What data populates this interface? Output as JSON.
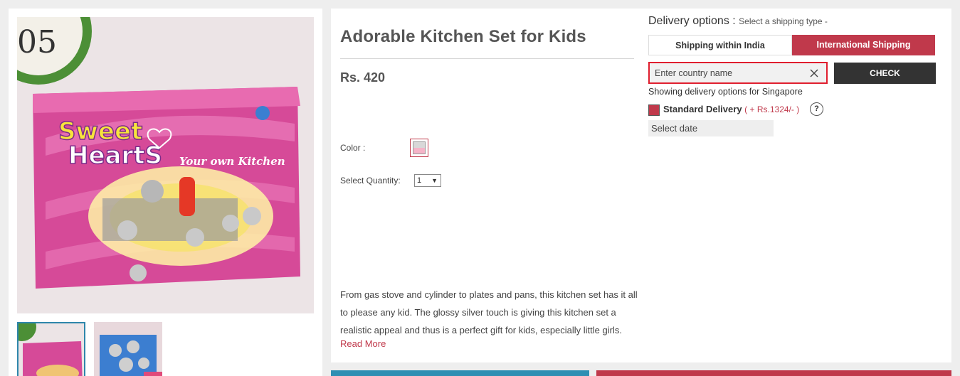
{
  "product": {
    "title": "Adorable Kitchen Set for Kids",
    "price": "Rs. 420",
    "color_label": "Color :",
    "quantity_label": "Select Quantity:",
    "quantity_value": "1",
    "description": "From gas stove and cylinder to plates and pans, this kitchen set has it all to please any kid. The glossy silver touch is giving this kitchen set a realistic appeal and thus is a perfect gift for kids, especially little girls.",
    "read_more": "Read More"
  },
  "image": {
    "box_title_line1": "Sweet",
    "box_title_line2": "HeartS",
    "box_tagline": "Your own Kitchen",
    "clock_text": "05"
  },
  "delivery": {
    "title": "Delivery options :",
    "subtitle": "Select a shipping type -",
    "tab_india": "Shipping within India",
    "tab_international": "International Shipping",
    "country_placeholder": "Enter country name",
    "check_label": "CHECK",
    "showing_text": "Showing delivery options for Singapore",
    "standard_label": "Standard Delivery",
    "standard_price": "( + Rs.1324/- )",
    "help_label": "?",
    "select_date": "Select date"
  },
  "colors": {
    "accent": "#c0394b",
    "dark_button": "#333333",
    "blue_bar": "#2e8fb3",
    "page_bg": "#eeeeee"
  }
}
